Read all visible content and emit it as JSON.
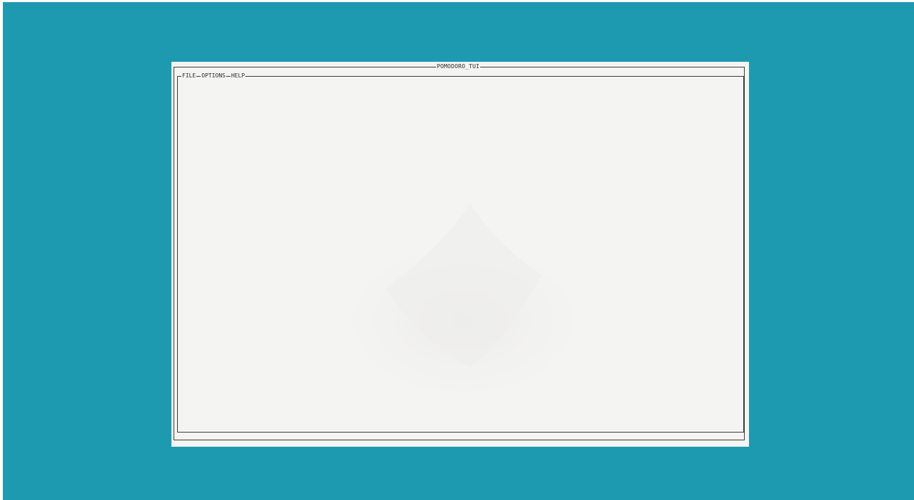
{
  "window": {
    "title": "POMODORO_TUI"
  },
  "menu": {
    "items": [
      {
        "label": "FILE"
      },
      {
        "label": "OPTIONS"
      },
      {
        "label": "HELP"
      }
    ]
  },
  "colors": {
    "desktop": "#1e9ab0",
    "terminal_bg": "#f4f4f3",
    "frame": "#3c3c3c"
  }
}
